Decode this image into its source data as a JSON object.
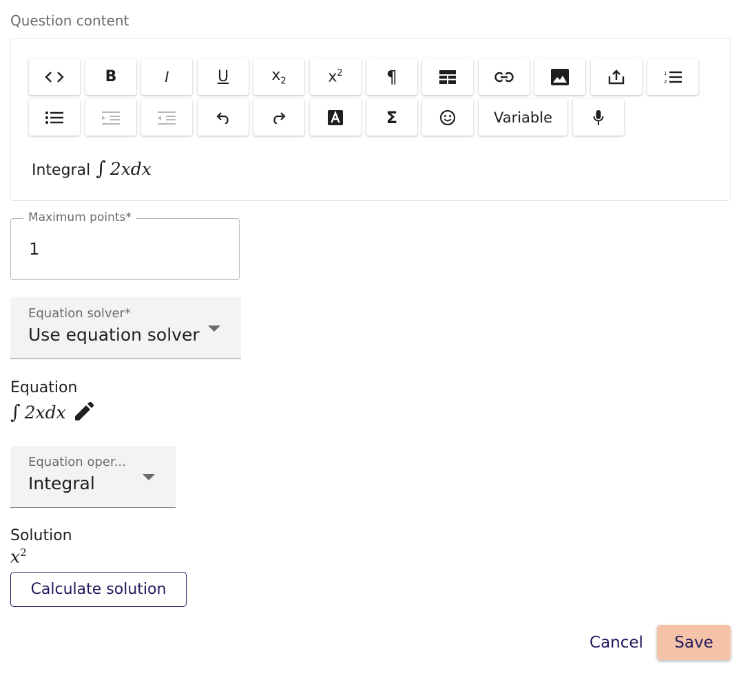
{
  "question_content": {
    "label": "Question content",
    "toolbar": {
      "subscript_main": "x",
      "subscript_sub": "2",
      "superscript_main": "x",
      "superscript_sup": "2",
      "variable_label": "Variable"
    },
    "content_text": "Integral",
    "content_math": "2xdx"
  },
  "max_points": {
    "label": "Maximum points*",
    "value": "1"
  },
  "equation_solver": {
    "label": "Equation solver*",
    "value": "Use equation solver"
  },
  "equation": {
    "label": "Equation",
    "math": "2xdx"
  },
  "equation_operation": {
    "label": "Equation oper...",
    "value": "Integral"
  },
  "solution": {
    "label": "Solution",
    "base": "x",
    "exponent": "2"
  },
  "buttons": {
    "calculate": "Calculate solution",
    "cancel": "Cancel",
    "save": "Save"
  },
  "colors": {
    "primary": "#1e1a5c",
    "save_bg": "#f5c4a8"
  }
}
